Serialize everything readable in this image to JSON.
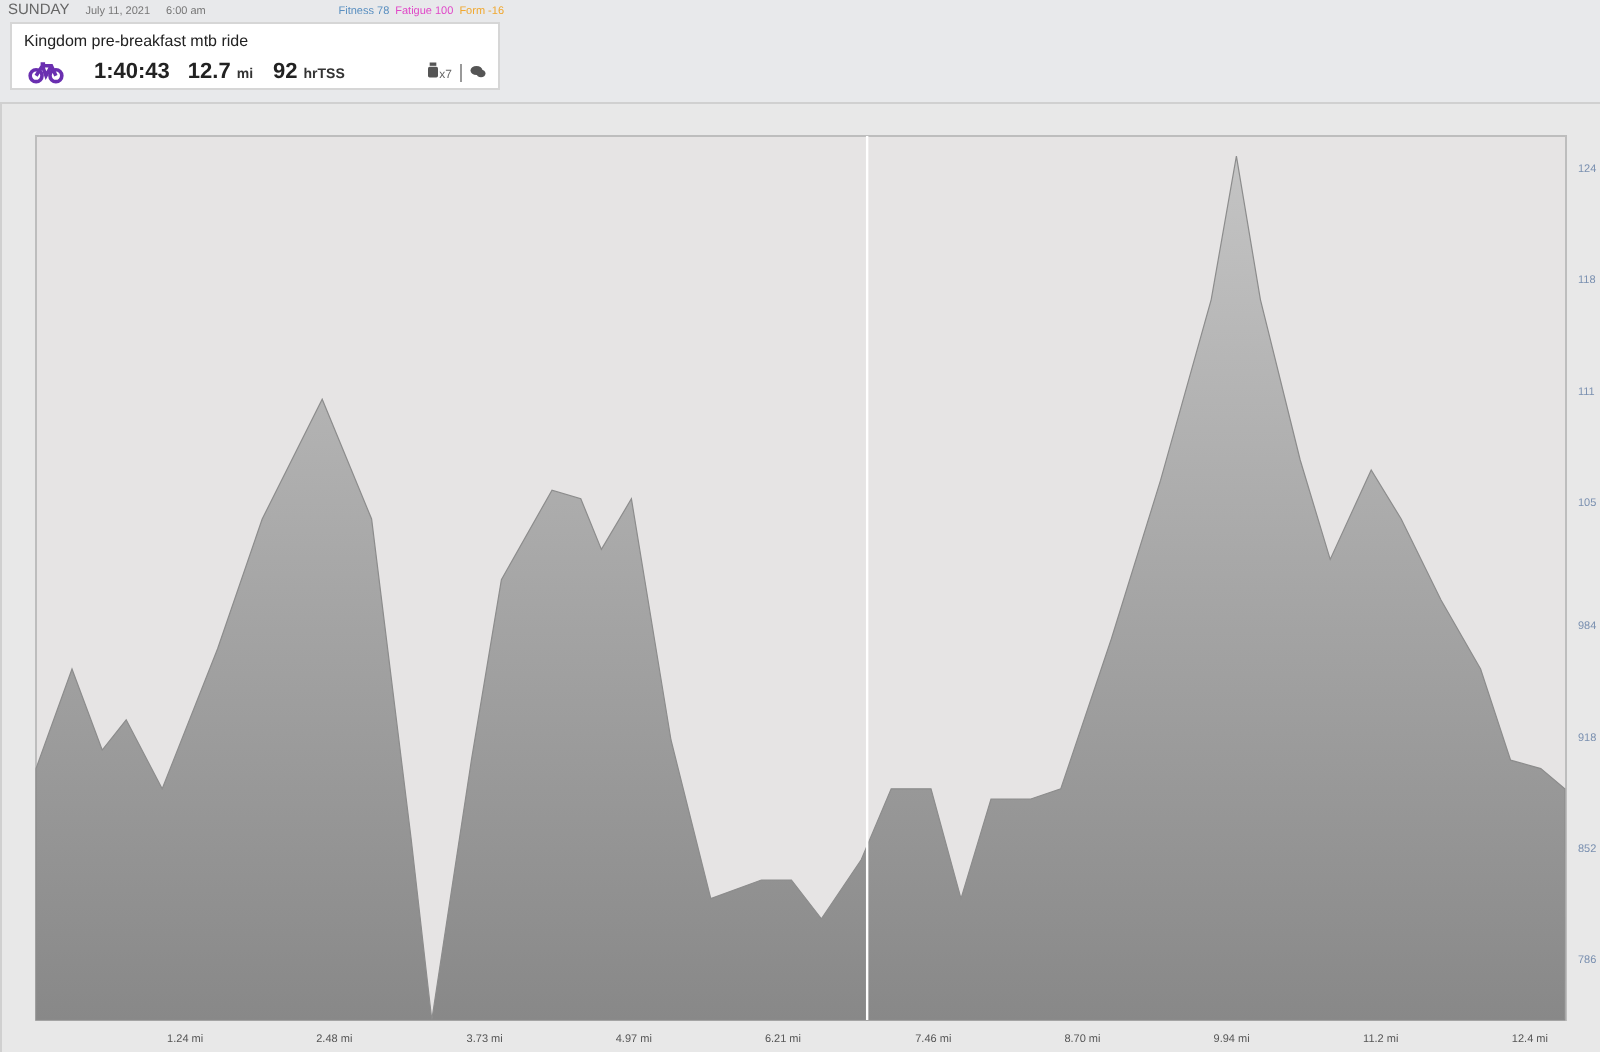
{
  "header": {
    "day": "SUNDAY",
    "date": "July 11, 2021",
    "time": "6:00 am",
    "metrics": [
      {
        "label": "Fitness 78",
        "color": "#5a8fc0"
      },
      {
        "label": "Fatigue 100",
        "color": "#e048c8"
      },
      {
        "label": "Form -16",
        "color": "#f0a830"
      }
    ]
  },
  "workout": {
    "title": "Kingdom pre-breakfast mtb ride",
    "duration": "1:40:43",
    "distance": "12.7",
    "distance_unit": "mi",
    "tss": "92",
    "tss_unit": "hrTSS",
    "device_count": "x7"
  },
  "chart": {
    "y_axis_labels": [
      "124",
      "118",
      "111",
      "105"
    ],
    "chart_data": {
      "type": "area",
      "xlim": [
        0,
        12.72
      ],
      "ylim": [
        750,
        1274
      ],
      "x": [
        0,
        0.3,
        0.55,
        0.75,
        1.05,
        1.51,
        1.88,
        2.38,
        2.79,
        3.12,
        3.29,
        3.62,
        3.87,
        4.29,
        4.53,
        4.7,
        4.95,
        5.28,
        5.61,
        6.03,
        6.28,
        6.53,
        6.86,
        7.11,
        7.44,
        7.69,
        7.94,
        8.27,
        8.52,
        8.94,
        9.35,
        9.77,
        9.98,
        10.18,
        10.51,
        10.76,
        11.1,
        11.35,
        11.68,
        12.01,
        12.26,
        12.51,
        12.71
      ],
      "series": [
        {
          "color": "#8c8c8c",
          "values": [
            899,
            958,
            910,
            928,
            887,
            970,
            1047,
            1118,
            1047,
            857,
            750,
            904,
            1011,
            1064,
            1059,
            1029,
            1059,
            916,
            822,
            833,
            833,
            810,
            845,
            887,
            887,
            822,
            881,
            881,
            887,
            976,
            1070,
            1177,
            1262,
            1177,
            1082,
            1023,
            1076,
            1047,
            999,
            958,
            904,
            899,
            887
          ]
        }
      ],
      "xticks": [
        {
          "value": 1.24,
          "label": "1.24 mi"
        },
        {
          "value": 2.48,
          "label": "2.48 mi"
        },
        {
          "value": 3.73,
          "label": "3.73 mi"
        },
        {
          "value": 4.97,
          "label": "4.97 mi"
        },
        {
          "value": 6.21,
          "label": "6.21 mi"
        },
        {
          "value": 7.46,
          "label": "7.46 mi"
        },
        {
          "value": 8.7,
          "label": "8.70 mi"
        },
        {
          "value": 9.94,
          "label": "9.94 mi"
        },
        {
          "value": 11.18,
          "label": "11.2 mi"
        },
        {
          "value": 12.42,
          "label": "12.4 mi"
        }
      ],
      "yticks": [
        984,
        918,
        852,
        786
      ],
      "ref_lines": [
        {
          "axis": "x",
          "value": 6.91
        }
      ]
    }
  }
}
